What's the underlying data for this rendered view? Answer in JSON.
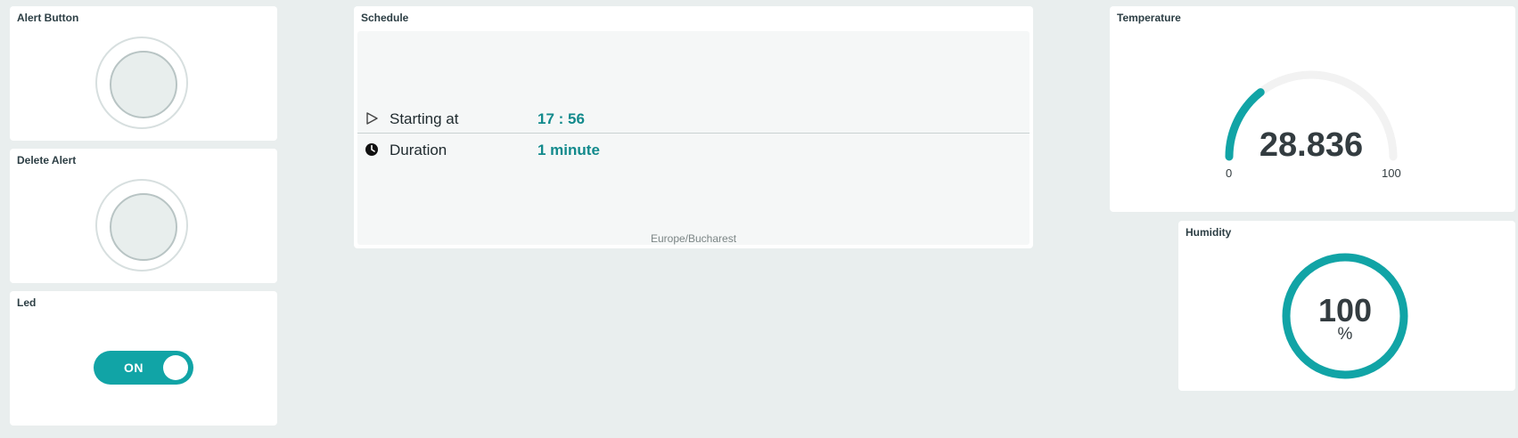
{
  "widgets": {
    "alert_button": {
      "title": "Alert Button"
    },
    "delete_alert": {
      "title": "Delete Alert"
    },
    "led": {
      "title": "Led",
      "state_label": "ON",
      "is_on": true
    },
    "schedule": {
      "title": "Schedule",
      "start_label": "Starting at",
      "start_value": "17 : 56",
      "duration_label": "Duration",
      "duration_value": "1 minute",
      "timezone": "Europe/Bucharest"
    },
    "temperature": {
      "title": "Temperature",
      "value": "28.836",
      "min": "0",
      "max": "100",
      "fraction": 0.28836
    },
    "humidity": {
      "title": "Humidity",
      "value": "100",
      "unit": "%",
      "fraction": 1.0
    }
  },
  "colors": {
    "accent": "#11a4a6",
    "accent_text": "#128a8c",
    "track": "#f2f2f2",
    "background": "#e9eeee"
  }
}
